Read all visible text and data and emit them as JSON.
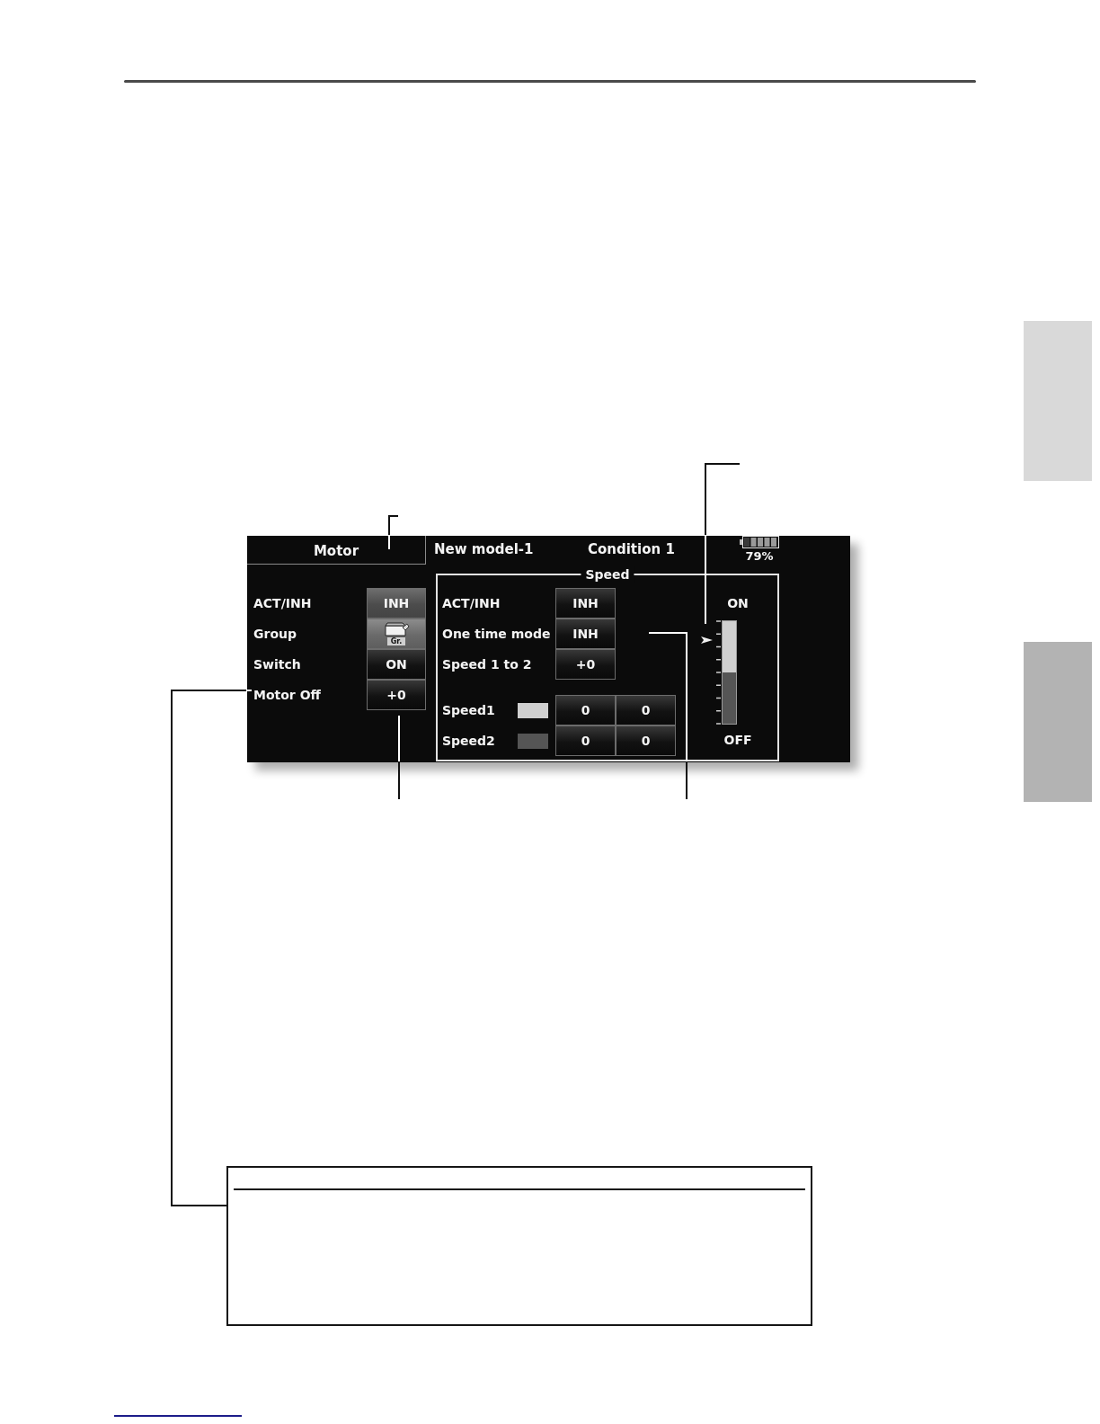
{
  "screen": {
    "title": "Motor",
    "model": "New model-1",
    "condition": "Condition 1",
    "battery": "79%"
  },
  "motor": {
    "rows": [
      {
        "label": "ACT/INH",
        "kind": "value",
        "value": "INH",
        "highlighted": true
      },
      {
        "label": "Group",
        "kind": "icon",
        "value": "Gr.",
        "highlighted": false
      },
      {
        "label": "Switch",
        "kind": "value",
        "value": "ON",
        "highlighted": false
      },
      {
        "label": "Motor Off",
        "kind": "value",
        "value": "+0",
        "highlighted": false
      }
    ]
  },
  "speed": {
    "title": "Speed",
    "rows": [
      {
        "label": "ACT/INH",
        "value": "INH"
      },
      {
        "label": "One time mode",
        "value": "INH"
      },
      {
        "label": "Speed 1 to 2",
        "value": "+0"
      }
    ],
    "table": [
      {
        "label": "Speed1",
        "color": "#d0d0d0",
        "values": [
          "0",
          "0"
        ]
      },
      {
        "label": "Speed2",
        "color": "#555555",
        "values": [
          "0",
          "0"
        ]
      }
    ],
    "meter": {
      "top_label": "ON",
      "bottom_label": "OFF",
      "level": 0.81
    }
  },
  "side_tabs": [
    {
      "color": "#d9d9d9"
    },
    {
      "color": "#b3b3b3"
    }
  ]
}
